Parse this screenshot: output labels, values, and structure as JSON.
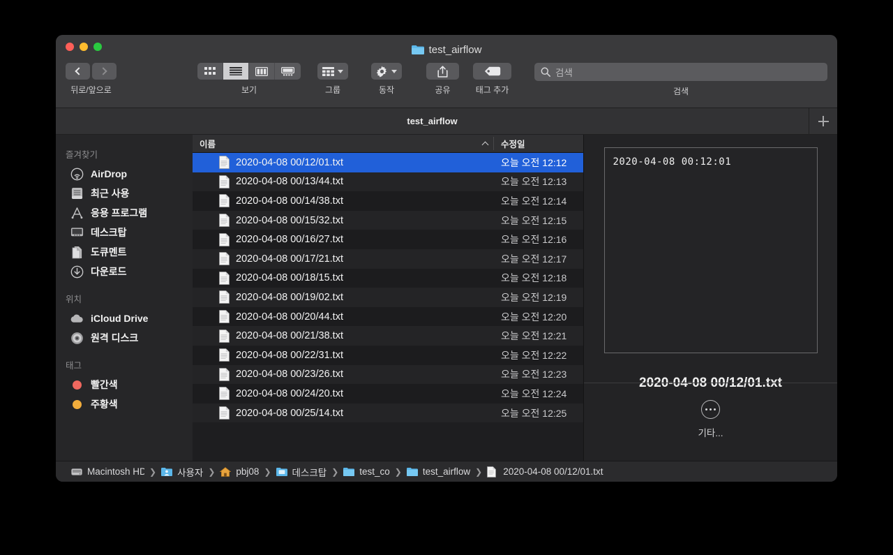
{
  "window": {
    "title": "test_airflow",
    "folder_icon": "folder-icon",
    "traffic_lights": [
      "close-red",
      "minimize-yellow",
      "zoom-green"
    ]
  },
  "toolbar": {
    "nav_label": "뒤로/앞으로",
    "back_icon": "chevron-left-icon",
    "forward_icon": "chevron-right-icon",
    "view_label": "보기",
    "view_modes": [
      {
        "name": "icon-view",
        "active": false
      },
      {
        "name": "list-view",
        "active": true
      },
      {
        "name": "column-view",
        "active": false
      },
      {
        "name": "gallery-view",
        "active": false
      }
    ],
    "group_label": "그룹",
    "group_icon": "grid-group-icon",
    "action_label": "동작",
    "action_icon": "gear-icon",
    "share_label": "공유",
    "share_icon": "share-icon",
    "tag_label": "태그 추가",
    "tag_icon": "tag-icon",
    "search_label": "검색",
    "search_placeholder": "검색",
    "search_value": "",
    "search_icon": "search-icon"
  },
  "tabbar": {
    "tabs": [
      {
        "label": "test_airflow",
        "active": true
      }
    ],
    "new_tab_icon": "plus-icon"
  },
  "sidebar": {
    "sections": [
      {
        "header": "즐겨찾기",
        "items": [
          {
            "label": "AirDrop",
            "icon": "airdrop-icon"
          },
          {
            "label": "최근 사용",
            "icon": "recents-icon"
          },
          {
            "label": "응용 프로그램",
            "icon": "applications-icon"
          },
          {
            "label": "데스크탑",
            "icon": "desktop-icon"
          },
          {
            "label": "도큐멘트",
            "icon": "documents-icon"
          },
          {
            "label": "다운로드",
            "icon": "downloads-icon"
          }
        ]
      },
      {
        "header": "위치",
        "items": [
          {
            "label": "iCloud Drive",
            "icon": "icloud-icon"
          },
          {
            "label": "원격 디스크",
            "icon": "remote-disc-icon"
          }
        ]
      },
      {
        "header": "태그",
        "items": [
          {
            "label": "빨간색",
            "icon": "tag-dot-icon",
            "color": "#f0685f"
          },
          {
            "label": "주황색",
            "icon": "tag-dot-icon",
            "color": "#f2ad3c"
          }
        ]
      }
    ]
  },
  "filelist": {
    "columns": [
      {
        "label": "이름",
        "sorted": "asc",
        "sort_icon": "chevron-up-icon"
      },
      {
        "label": "수정일"
      }
    ],
    "rows": [
      {
        "name": "2020-04-08 00/12/01.txt",
        "modified": "오늘 오전 12:12",
        "selected": true
      },
      {
        "name": "2020-04-08 00/13/44.txt",
        "modified": "오늘 오전 12:13",
        "selected": false
      },
      {
        "name": "2020-04-08 00/14/38.txt",
        "modified": "오늘 오전 12:14",
        "selected": false
      },
      {
        "name": "2020-04-08 00/15/32.txt",
        "modified": "오늘 오전 12:15",
        "selected": false
      },
      {
        "name": "2020-04-08 00/16/27.txt",
        "modified": "오늘 오전 12:16",
        "selected": false
      },
      {
        "name": "2020-04-08 00/17/21.txt",
        "modified": "오늘 오전 12:17",
        "selected": false
      },
      {
        "name": "2020-04-08 00/18/15.txt",
        "modified": "오늘 오전 12:18",
        "selected": false
      },
      {
        "name": "2020-04-08 00/19/02.txt",
        "modified": "오늘 오전 12:19",
        "selected": false
      },
      {
        "name": "2020-04-08 00/20/44.txt",
        "modified": "오늘 오전 12:20",
        "selected": false
      },
      {
        "name": "2020-04-08 00/21/38.txt",
        "modified": "오늘 오전 12:21",
        "selected": false
      },
      {
        "name": "2020-04-08 00/22/31.txt",
        "modified": "오늘 오전 12:22",
        "selected": false
      },
      {
        "name": "2020-04-08 00/23/26.txt",
        "modified": "오늘 오전 12:23",
        "selected": false
      },
      {
        "name": "2020-04-08 00/24/20.txt",
        "modified": "오늘 오전 12:24",
        "selected": false
      },
      {
        "name": "2020-04-08 00/25/14.txt",
        "modified": "오늘 오전 12:25",
        "selected": false
      }
    ]
  },
  "preview": {
    "thumbnail_text": "2020-04-08 00:12:01",
    "filename": "2020-04-08 00/12/01.txt",
    "more_label": "기타...",
    "more_icon": "ellipsis-circle-icon"
  },
  "pathbar": {
    "crumbs": [
      {
        "label": "Macintosh HD",
        "icon": "hard-disk-icon"
      },
      {
        "label": "사용자",
        "icon": "users-folder-icon"
      },
      {
        "label": "pbj08",
        "icon": "home-icon"
      },
      {
        "label": "데스크탑",
        "icon": "desktop-folder-icon"
      },
      {
        "label": "test_co",
        "icon": "folder-icon"
      },
      {
        "label": "test_airflow",
        "icon": "folder-icon"
      },
      {
        "label": "2020-04-08 00/12/01.txt",
        "icon": "document-icon"
      }
    ]
  },
  "colors": {
    "selection_blue": "#2160d9",
    "folder_blue": "#61bdf0",
    "window_bg": "#2c2c2e"
  }
}
